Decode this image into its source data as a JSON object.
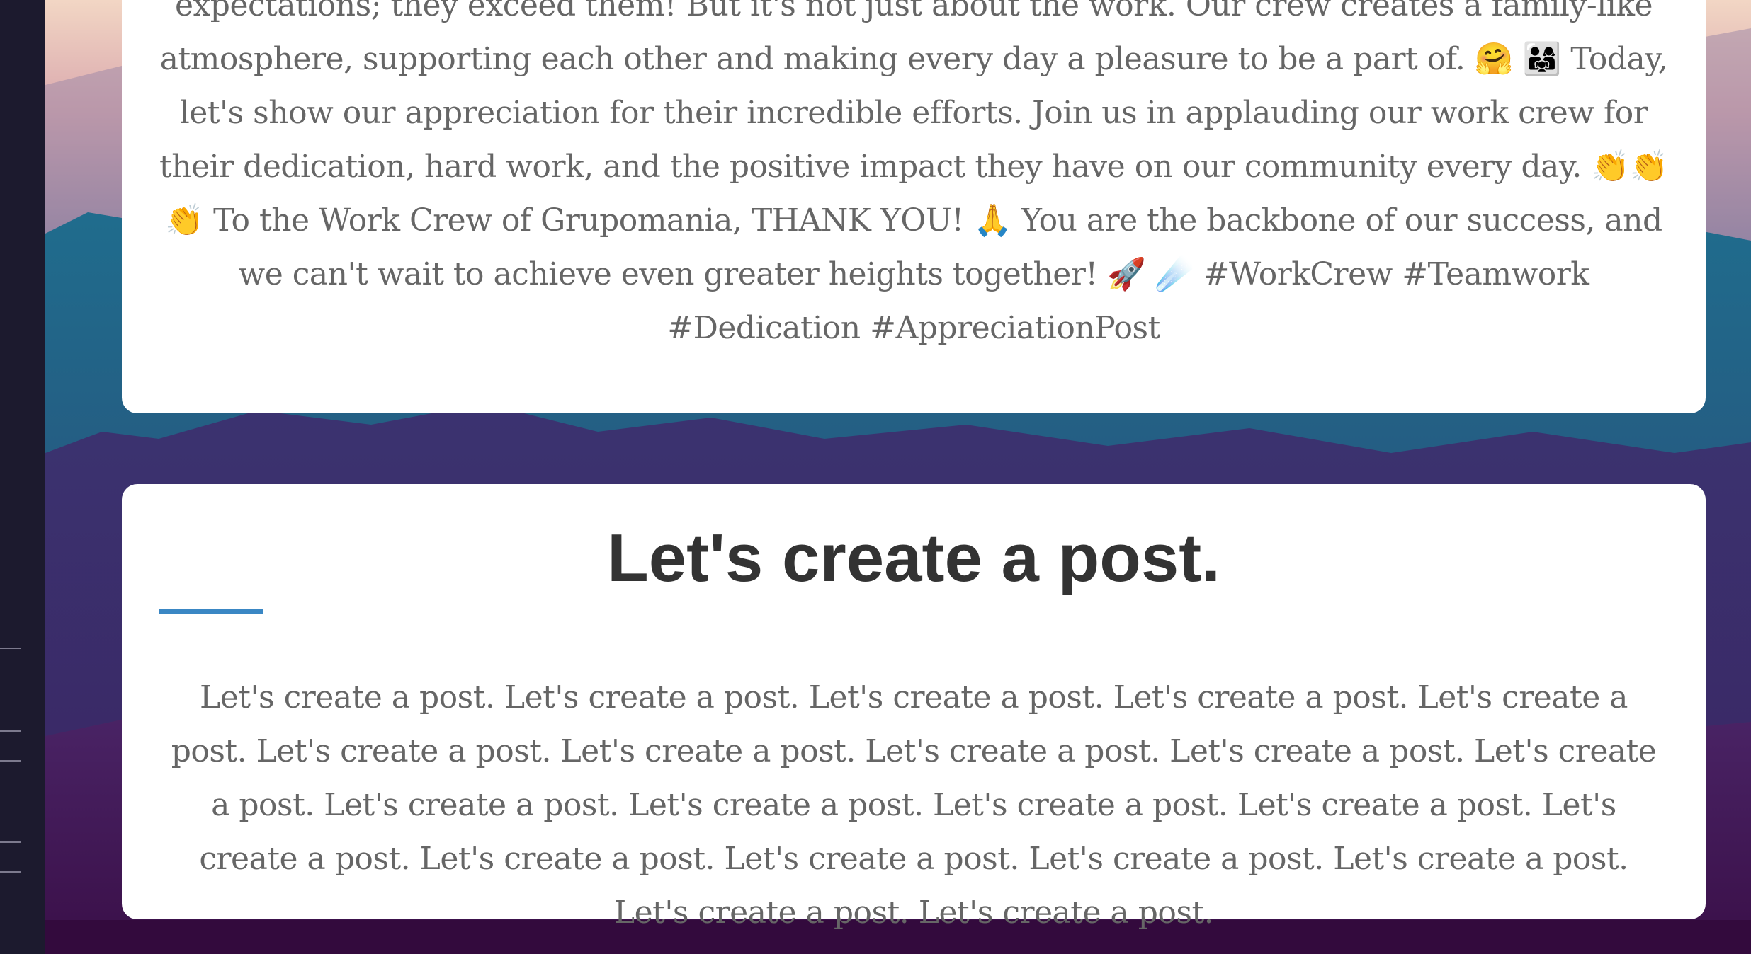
{
  "posts": [
    {
      "body": "expectations; they exceed them! But it's not just about the work. Our crew creates a family-like atmosphere, supporting each other and making every day a pleasure to be a part of. 🤗 👨‍👩‍👧 Today, let's show our appreciation for their incredible efforts. Join us in applauding our work crew for their dedication, hard work, and the positive impact they have on our community every day. 👏👏👏 To the Work Crew of Grupomania, THANK YOU! 🙏 You are the backbone of our success, and we can't wait to achieve even greater heights together! 🚀 ☄️ #WorkCrew #Teamwork #Dedication #AppreciationPost"
    },
    {
      "title": "Let's create a post.",
      "body": "Let's create a post. Let's create a post. Let's create a post. Let's create a post. Let's create a post. Let's create a post. Let's create a post. Let's create a post. Let's create a post. Let's create a post. Let's create a post. Let's create a post. Let's create a post. Let's create a post. Let's create a post. Let's create a post. Let's create a post. Let's create a post. Let's create a post. Let's create a post. Let's create a post."
    }
  ],
  "colors": {
    "card_background": "#ffffff",
    "body_text": "#666666",
    "title_text": "#333333",
    "accent_underline": "#3a87c4",
    "sidebar": "#1c1a2e"
  }
}
